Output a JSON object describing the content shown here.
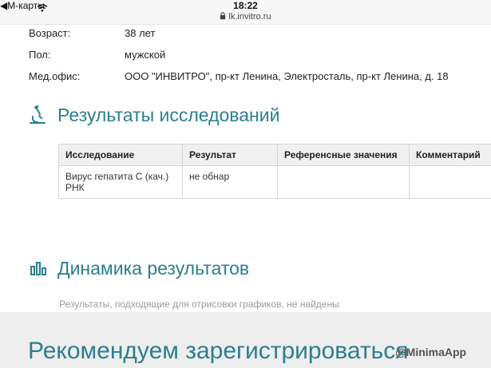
{
  "status_bar": {
    "carrier": "◀М-карты",
    "time": "18:22",
    "url": "lk.invitro.ru"
  },
  "patient": {
    "age_label": "Возраст:",
    "age_value": "38 лет",
    "sex_label": "Пол:",
    "sex_value": "мужской",
    "office_label": "Мед.офис:",
    "office_value": "ООО \"ИНВИТРО\", пр-кт Ленина, Электросталь, пр-кт Ленина, д. 18"
  },
  "results": {
    "title": "Результаты исследований",
    "columns": [
      "Исследование",
      "Результат",
      "Референсные значения",
      "Комментарий"
    ],
    "rows": [
      {
        "test": "Вирус гепатита С (кач.) РНК",
        "result": "не обнар",
        "reference": "",
        "comment": ""
      }
    ]
  },
  "dynamics": {
    "title": "Динамика результатов",
    "empty_text": "Результаты, подходящие для отрисовки графиков, не найдены"
  },
  "register": {
    "title": "Рекомендуем зарегистрироваться"
  },
  "watermark": "@MinimaApp",
  "colors": {
    "accent": "#2a7f8f",
    "muted_text": "#9a9a9a",
    "table_header_bg": "#f0f0f0"
  },
  "icons": {
    "results": "microscope-icon",
    "dynamics": "bar-chart-icon",
    "wifi": "wifi-icon",
    "lock": "lock-icon"
  }
}
